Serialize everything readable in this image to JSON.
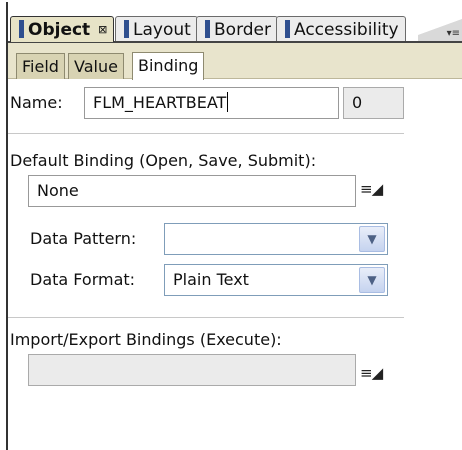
{
  "tabs": [
    {
      "label": "Object",
      "active": true,
      "close_glyph": "⊠"
    },
    {
      "label": "Layout",
      "active": false
    },
    {
      "label": "Border",
      "active": false
    },
    {
      "label": "Accessibility",
      "active": false
    }
  ],
  "tab_overflow_icon": "chevron-overflow-icon",
  "subtabs": [
    {
      "label": "Field",
      "active": false
    },
    {
      "label": "Value",
      "active": false
    },
    {
      "label": "Binding",
      "active": true
    }
  ],
  "name": {
    "label": "Name:",
    "value": "FLM_HEARTBEAT",
    "index": "0"
  },
  "default_binding": {
    "label": "Default Binding (Open, Save, Submit):",
    "value": "None",
    "picker_glyph": "≡◢"
  },
  "data_pattern": {
    "label": "Data Pattern:",
    "value": ""
  },
  "data_format": {
    "label": "Data Format:",
    "value": "Plain Text"
  },
  "import_export": {
    "label": "Import/Export Bindings (Execute):",
    "value": "",
    "picker_glyph": "≡◢"
  },
  "colors": {
    "active_tab_bg": "#e7e3c7",
    "subtab_strip_bg": "#e8e4cc",
    "tab_lead_marker": "#2f4f8f"
  }
}
